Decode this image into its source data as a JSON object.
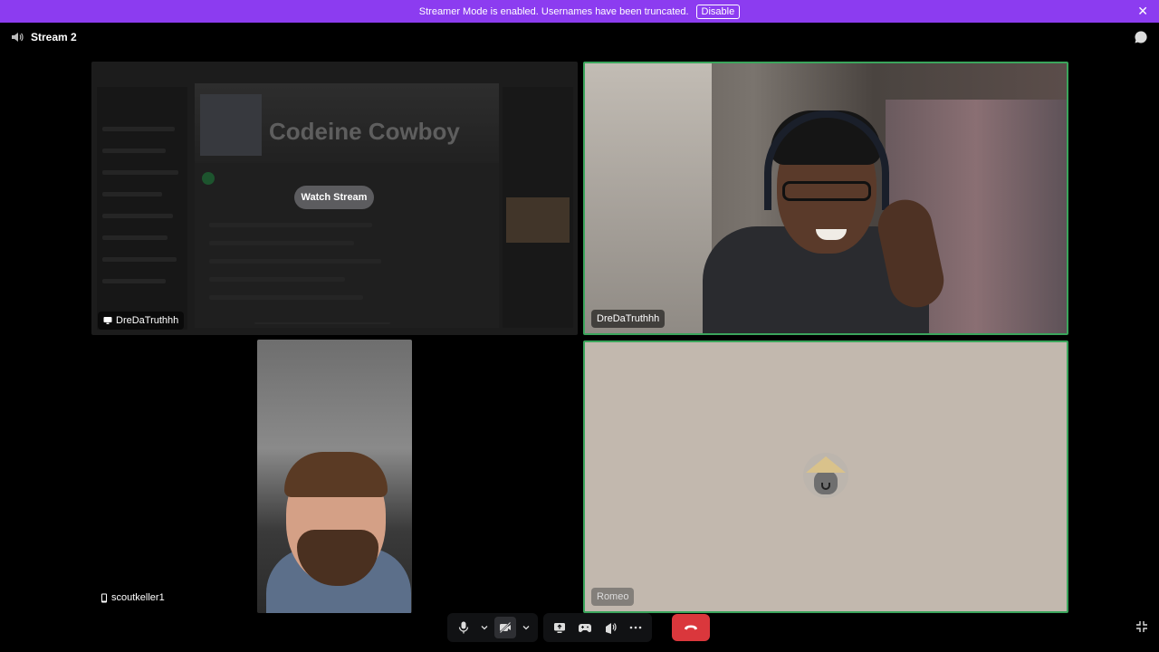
{
  "banner": {
    "message": "Streamer Mode is enabled. Usernames have been truncated.",
    "disable_label": "Disable",
    "close_icon": "close-icon",
    "color": "#8c3cf0"
  },
  "topbar": {
    "channel_name": "Stream 2",
    "icon": "speaker-icon"
  },
  "tiles": {
    "stream": {
      "app_title": "Codeine Cowboy",
      "watch_label": "Watch Stream",
      "user": "DreDaTruthhh",
      "icon": "screen-share-icon"
    },
    "cam1": {
      "user": "DreDaTruthhh"
    },
    "cam2": {
      "user": "scoutkeller1",
      "icon": "mobile-icon"
    },
    "avatar": {
      "user": "Romeo"
    }
  },
  "controls": {
    "mic": "microphone-icon",
    "camera": "camera-off-icon",
    "share": "screen-share-icon",
    "activity": "gamepad-icon",
    "soundboard": "soundboard-icon",
    "more": "more-icon",
    "disconnect": "end-call-icon",
    "end_call_color": "#da373c"
  },
  "accent": {
    "speaking_border": "#3ba55c"
  }
}
